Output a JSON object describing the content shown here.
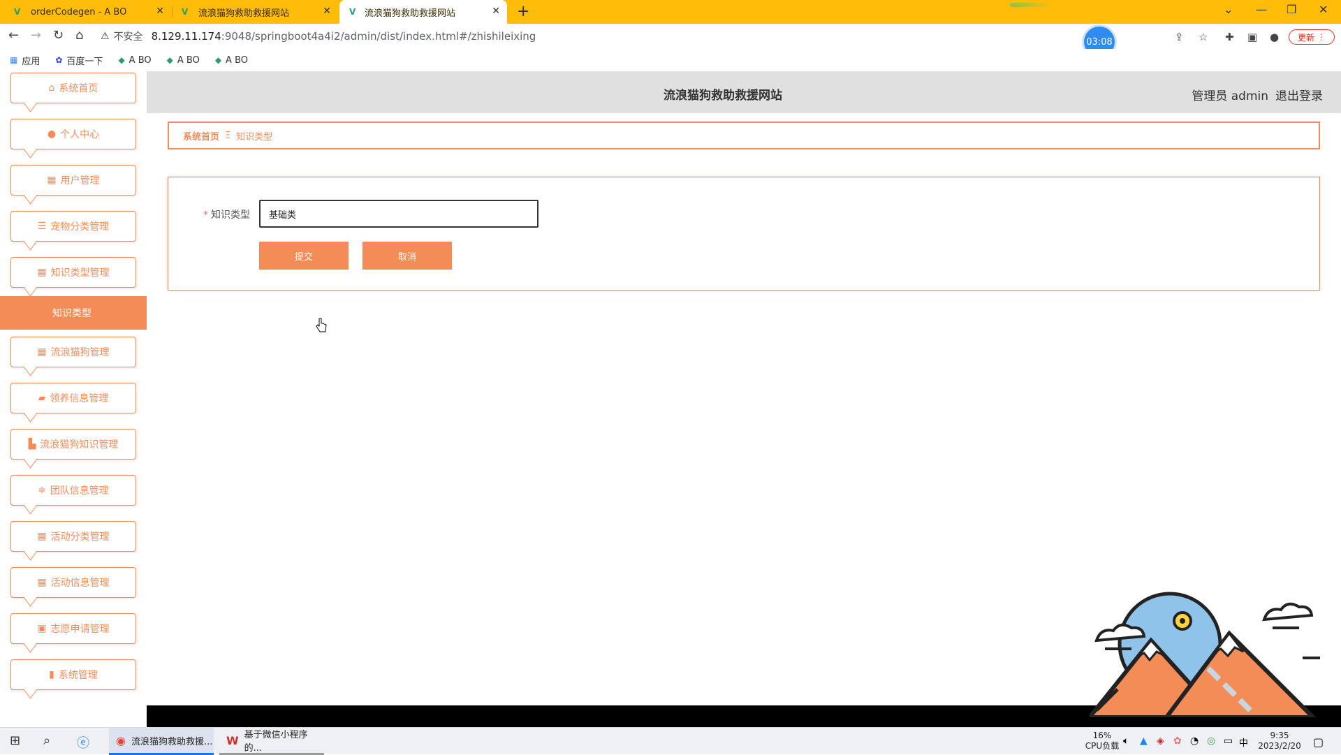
{
  "browser": {
    "tabs": [
      {
        "title": "orderCodegen - A BO"
      },
      {
        "title": "流浪猫狗救助救援网站"
      },
      {
        "title": "流浪猫狗救助救援网站"
      }
    ],
    "new_tab": "+",
    "url": {
      "insecure_label": "不安全",
      "host": "8.129.11.174",
      "path": ":9048/springboot4a4i2/admin/dist/index.html#/zhishileixing"
    },
    "timer": "03:08",
    "update_label": "更新",
    "bookmarks": [
      "应用",
      "百度一下",
      "A BO",
      "A BO",
      "A BO"
    ]
  },
  "sidebar": {
    "items": [
      {
        "label": "系统首页",
        "icon": "home-icon"
      },
      {
        "label": "个人中心",
        "icon": "user-icon"
      },
      {
        "label": "用户管理",
        "icon": "grid-icon"
      },
      {
        "label": "宠物分类管理",
        "icon": "list-icon"
      },
      {
        "label": "知识类型管理",
        "icon": "grid-icon"
      },
      {
        "label": "流浪猫狗管理",
        "icon": "grid-icon"
      },
      {
        "label": "领养信息管理",
        "icon": "ticket-icon"
      },
      {
        "label": "流浪猫狗知识管理",
        "icon": "briefcase-icon"
      },
      {
        "label": "团队信息管理",
        "icon": "sliders-icon"
      },
      {
        "label": "活动分类管理",
        "icon": "grid-icon"
      },
      {
        "label": "活动信息管理",
        "icon": "grid-icon"
      },
      {
        "label": "志愿申请管理",
        "icon": "clipboard-icon"
      },
      {
        "label": "系统管理",
        "icon": "bar-chart-icon"
      }
    ],
    "active_submenu": "知识类型"
  },
  "header": {
    "title": "流浪猫狗救助救援网站",
    "user": "管理员 admin",
    "logout": "退出登录"
  },
  "breadcrumb": {
    "home": "系统首页",
    "separator": "Ξ",
    "current": "知识类型"
  },
  "form": {
    "required_mark": "*",
    "label": "知识类型",
    "value": "基础类",
    "submit": "提交",
    "cancel": "取消"
  },
  "taskbar": {
    "apps": [
      "流浪猫狗救助救援...",
      "基于微信小程序的..."
    ],
    "cpu_percent": "16%",
    "cpu_label": "CPU负载",
    "ime": "中",
    "time": "9:35",
    "date": "2023/2/20"
  },
  "colors": {
    "accent": "#f48c58",
    "tabbar": "#ffbd0a",
    "header_bg": "#e0e0e0"
  }
}
